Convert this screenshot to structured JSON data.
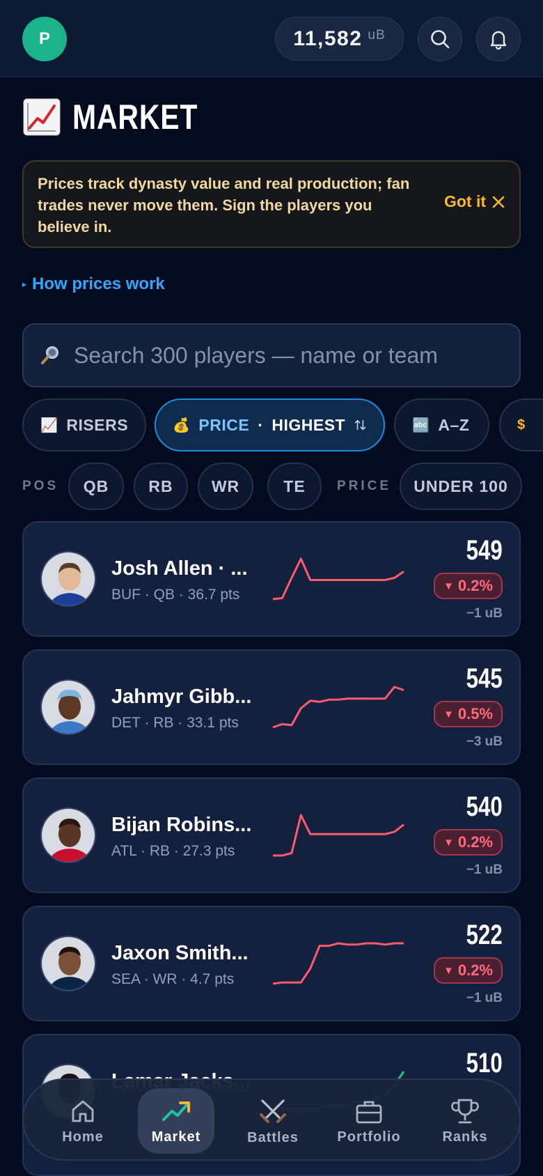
{
  "header": {
    "avatar_initial": "P",
    "balance_amount": "11,582",
    "balance_unit": "uB"
  },
  "page": {
    "title_emoji": "📈",
    "title": "MARKET"
  },
  "notice": {
    "message": "Prices track dynasty value and real production; fan trades never move them. Sign the players you believe in.",
    "dismiss_label": "Got it"
  },
  "how_link": "How prices work",
  "search": {
    "placeholder": "Search 300 players — name or team"
  },
  "sort_chips": [
    {
      "icon": "📈",
      "label": "RISERS"
    },
    {
      "icon": "💰",
      "label": "PRICE",
      "extra": "HIGHEST",
      "active": true
    },
    {
      "icon": "🔤",
      "label": "A–Z"
    }
  ],
  "filters": {
    "pos_label": "POS",
    "positions": [
      "QB",
      "RB",
      "WR",
      "TE"
    ],
    "price_label": "PRICE",
    "price_options": [
      "UNDER 100"
    ]
  },
  "colors": {
    "down": "#ff5b6b",
    "up": "#21c486",
    "accent_blue": "#2ea7ff",
    "accent_gold": "#f7b731"
  },
  "players": [
    {
      "name": "Josh Allen · ...",
      "team": "BUF",
      "pos": "QB",
      "pts": "36.7 pts",
      "meta": "BUF · QB · 36.7 pts",
      "price": "549",
      "change": "0.2%",
      "delta": "−1 uB",
      "trend": "down",
      "spark": [
        10,
        11,
        30,
        48,
        28,
        28,
        28,
        28,
        28,
        28,
        28,
        28,
        28,
        30,
        36
      ]
    },
    {
      "name": "Jahmyr Gibb...",
      "team": "DET",
      "pos": "RB",
      "pts": "33.1 pts",
      "meta": "DET · RB · 33.1 pts",
      "price": "545",
      "change": "0.5%",
      "delta": "−3 uB",
      "trend": "down",
      "spark": [
        10,
        13,
        12,
        28,
        35,
        34,
        36,
        36,
        37,
        37,
        37,
        37,
        37,
        48,
        45
      ]
    },
    {
      "name": "Bijan Robins...",
      "team": "ATL",
      "pos": "RB",
      "pts": "27.3 pts",
      "meta": "ATL · RB · 27.3 pts",
      "price": "540",
      "change": "0.2%",
      "delta": "−1 uB",
      "trend": "down",
      "spark": [
        12,
        12,
        14,
        46,
        30,
        30,
        30,
        30,
        30,
        30,
        30,
        30,
        30,
        32,
        38
      ]
    },
    {
      "name": "Jaxon Smith...",
      "team": "SEA",
      "pos": "WR",
      "pts": "4.7 pts",
      "meta": "SEA · WR · 4.7 pts",
      "price": "522",
      "change": "0.2%",
      "delta": "−1 uB",
      "trend": "down",
      "spark": [
        10,
        11,
        11,
        11,
        22,
        40,
        40,
        42,
        41,
        41,
        42,
        42,
        41,
        42,
        42
      ]
    },
    {
      "name": "Lamar Jacks...",
      "team": "",
      "pos": "",
      "pts": "",
      "meta": "",
      "price": "510",
      "change": "",
      "delta": "",
      "trend": "up",
      "spark": [
        10,
        11,
        11,
        11,
        11,
        11,
        12,
        12,
        12,
        13,
        13,
        14,
        15,
        18,
        22
      ]
    }
  ],
  "nav": [
    {
      "label": "Home",
      "icon": "home-icon"
    },
    {
      "label": "Market",
      "icon": "trending-icon",
      "active": true
    },
    {
      "label": "Battles",
      "icon": "swords-icon"
    },
    {
      "label": "Portfolio",
      "icon": "briefcase-icon"
    },
    {
      "label": "Ranks",
      "icon": "trophy-icon"
    }
  ]
}
